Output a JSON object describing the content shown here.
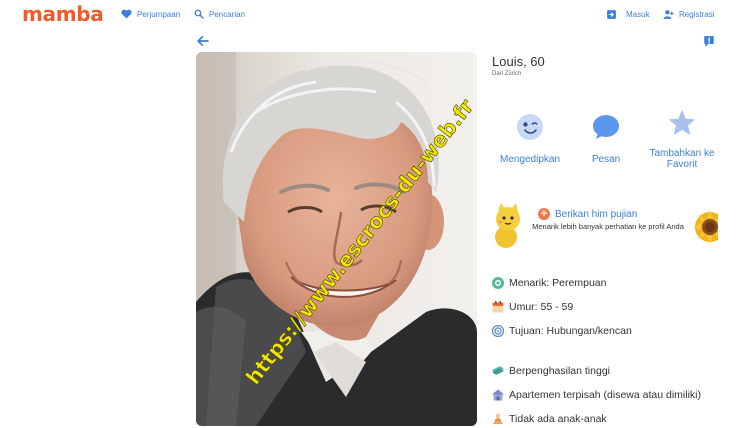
{
  "header": {
    "logo": "mamba",
    "nav": [
      {
        "label": "Perjumpaan",
        "icon": "heart-icon"
      },
      {
        "label": "Pencarian",
        "icon": "search-icon"
      },
      {
        "label": "Masuk",
        "icon": "login-icon"
      },
      {
        "label": "Registrasi",
        "icon": "user-icon"
      }
    ]
  },
  "profile": {
    "name": "Louis, 60",
    "city": "Dari Zürich",
    "watermark": "https://www.escrocs-du-web.fr"
  },
  "actions": [
    {
      "label": "Mengedipkan",
      "icon": "wink-icon"
    },
    {
      "label": "Pesan",
      "icon": "message-icon"
    },
    {
      "label": "Tambahkan ke Favorit",
      "icon": "star-icon"
    }
  ],
  "compliment": {
    "title": "Berikan him pujian",
    "subtitle": "Menarik lebih banyak perhatian ke profil Anda"
  },
  "details": [
    {
      "text": "Menarik: Perempuan",
      "icon": "gender-icon"
    },
    {
      "text": "Umur: 55 - 59",
      "icon": "calendar-icon"
    },
    {
      "text": "Tujuan: Hubungan/kencan",
      "icon": "target-icon"
    },
    {
      "text": "Berpenghasilan tinggi",
      "icon": "money-icon"
    },
    {
      "text": "Apartemen terpisah (disewa atau dimiliki)",
      "icon": "house-icon"
    },
    {
      "text": "Tidak ada anak-anak",
      "icon": "no-children-icon"
    }
  ],
  "colors": {
    "brand": "#ef5b2a",
    "link": "#3d7fd6"
  }
}
